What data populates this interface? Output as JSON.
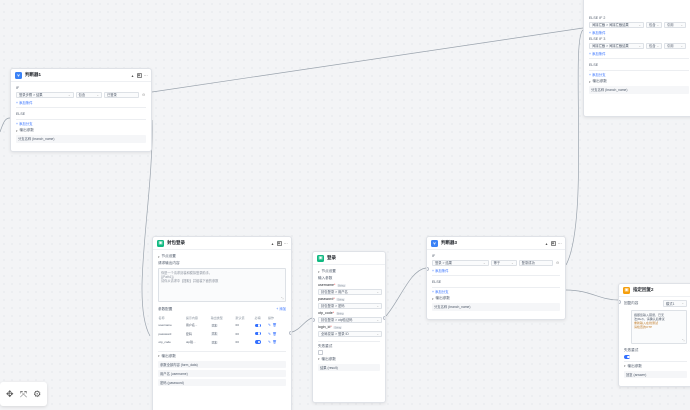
{
  "colors": {
    "branch_icon": "#3b82f6",
    "pack_icon": "#10b981",
    "login_icon": "#10b981",
    "code_icon": "#f59e0b",
    "accent": "#3370ff",
    "edge": "#9aa3ad"
  },
  "branch_top": {
    "elseif2_label": "ELSE IF 2",
    "elseif2_cond": {
      "left": "间接拦截 > 间接拦截结果",
      "op": "包含",
      "right": "引用"
    },
    "elseif3_label": "ELSE IF 3",
    "elseif3_cond": {
      "left": "间接拦截 > 间接拦截结果",
      "op": "包含",
      "right": "引用"
    },
    "add_condition": "+ 添加条件",
    "else_label": "ELSE",
    "add_branch": "+ 添加分支",
    "output_label": "输出参数",
    "output_var": "分支名称 (branch_name)"
  },
  "branch1": {
    "title": "判断器1",
    "if_label": "IF",
    "cond": {
      "left": "登录步骤 > 结果",
      "op": "包含",
      "right": "已登录"
    },
    "add_condition": "+ 添加条件",
    "else_label": "ELSE",
    "add_branch": "+ 添加分支",
    "output_label": "输出参数",
    "output_var": "分支名称 (branch_name)"
  },
  "pack": {
    "title": "封包登录",
    "section_label": "节点设置",
    "prompt_label": "请求输出内容",
    "prompt_text": [
      "你是一个请求封装和模拟登录助手。",
      "{{Path1}}",
      "请你从请求中【提取】并组装下面的参数"
    ],
    "vars_label": "参数配置",
    "add_label": "添加",
    "columns": [
      "名称",
      "提示内容",
      "输出类型",
      "默认值",
      "必填",
      "操作"
    ],
    "rows": [
      {
        "name": "username",
        "hint": "用户名...",
        "type": "文本",
        "default": "00"
      },
      {
        "name": "password",
        "hint": "密码",
        "type": "文本",
        "default": "00"
      },
      {
        "name": "otp_code",
        "hint": "otp验...",
        "type": "文本",
        "default": "00"
      }
    ],
    "output_label": "输出参数",
    "outputs": [
      "参数全部内容 (form_data)",
      "用户名 (username)",
      "密码 (password)"
    ]
  },
  "login": {
    "title": "登录",
    "section_label": "节点设置",
    "inputs_label": "输入参数",
    "fields": [
      {
        "label": "username",
        "tag": "String",
        "value": "封包登录 > 用户名"
      },
      {
        "label": "password",
        "tag": "String",
        "value": "封包登录 > 密码"
      },
      {
        "label": "otp_code",
        "tag": "String",
        "value": "封包登录 > otp验证码"
      },
      {
        "label": "login_id",
        "tag": "String",
        "value": "全局变量 > 登录 ID"
      }
    ],
    "retry_label": "失败重试",
    "output_label": "输出参数",
    "output_var": "结果 (result)"
  },
  "branch3": {
    "title": "判断器3",
    "if_label": "IF",
    "cond": {
      "left": "登录 > 结果",
      "op": "等于",
      "right": "登录成功"
    },
    "add_condition": "+ 添加条件",
    "else_label": "ELSE",
    "add_branch": "+ 添加分支",
    "output_label": "输出参数",
    "output_var": "分支名称 (branch_name)"
  },
  "code2": {
    "title": "指定回复2",
    "reply_label": "回复内容",
    "reply_mode": "模式1",
    "code_lines": [
      "抱歉您输入错误，已无",
      "法(Ref)，请确认后重试",
      "重新输入在线测试",
      "请检查的OTP"
    ],
    "retry_label": "失败重试",
    "output_label": "输出参数",
    "output_var": "回复 (answer)"
  },
  "toolbar": {
    "items": [
      {
        "name": "move-icon",
        "glyph": "✥"
      },
      {
        "name": "expand-icon",
        "glyph": "⤧"
      },
      {
        "name": "settings-icon",
        "glyph": "⚙"
      }
    ]
  }
}
